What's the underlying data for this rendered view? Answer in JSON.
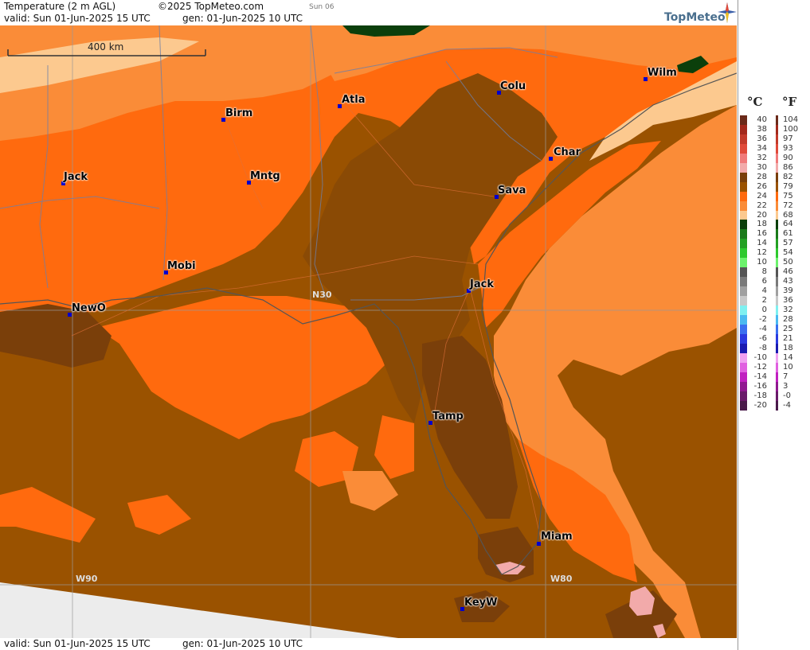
{
  "header": {
    "title": "Temperature (2 m AGL)",
    "copyright": "©2025 TopMeteo.com",
    "valid": "valid:  Sun  01-Jun-2025  15 UTC",
    "gen": "gen: 01-Jun-2025 10 UTC",
    "day": "Sun 06"
  },
  "footer": {
    "valid": "valid:  Sun  01-Jun-2025  15 UTC",
    "gen": "gen: 01-Jun-2025 10 UTC"
  },
  "logo": "TopMeteo",
  "scale_label": "400 km",
  "grid_labels": {
    "lat": "N30",
    "lon_w90": "W90",
    "lon_w80": "W80"
  },
  "cities": [
    {
      "name": "Birm"
    },
    {
      "name": "Atla"
    },
    {
      "name": "Colu"
    },
    {
      "name": "Wilm"
    },
    {
      "name": "Jack"
    },
    {
      "name": "Mntg"
    },
    {
      "name": "Char"
    },
    {
      "name": "Sava"
    },
    {
      "name": "Mobi"
    },
    {
      "name": "Jack"
    },
    {
      "name": "NewO"
    },
    {
      "name": "Tamp"
    },
    {
      "name": "Miam"
    },
    {
      "name": "KeyW"
    }
  ],
  "legend": {
    "unit_c": "°C",
    "unit_f": "°F",
    "rows": [
      {
        "c": "40",
        "f": "104",
        "color": "#6b2a1a"
      },
      {
        "c": "38",
        "f": "100",
        "color": "#a3291c"
      },
      {
        "c": "36",
        "f": "97",
        "color": "#c23a2a"
      },
      {
        "c": "34",
        "f": "93",
        "color": "#e04a3a"
      },
      {
        "c": "32",
        "f": "90",
        "color": "#f07a7a"
      },
      {
        "c": "30",
        "f": "86",
        "color": "#f2aaaa"
      },
      {
        "c": "28",
        "f": "82",
        "color": "#7a3f0a"
      },
      {
        "c": "26",
        "f": "79",
        "color": "#9a5200"
      },
      {
        "c": "24",
        "f": "75",
        "color": "#ff6a0e"
      },
      {
        "c": "22",
        "f": "72",
        "color": "#fa8c38"
      },
      {
        "c": "20",
        "f": "68",
        "color": "#fcc98f"
      },
      {
        "c": "18",
        "f": "64",
        "color": "#0b3f0b"
      },
      {
        "c": "16",
        "f": "61",
        "color": "#1a7a1a"
      },
      {
        "c": "14",
        "f": "57",
        "color": "#23a023"
      },
      {
        "c": "12",
        "f": "54",
        "color": "#2ec92e"
      },
      {
        "c": "10",
        "f": "50",
        "color": "#6cf26c"
      },
      {
        "c": "8",
        "f": "46",
        "color": "#555555"
      },
      {
        "c": "6",
        "f": "43",
        "color": "#7a7a7a"
      },
      {
        "c": "4",
        "f": "39",
        "color": "#a0a0a0"
      },
      {
        "c": "2",
        "f": "36",
        "color": "#c8c8c8"
      },
      {
        "c": "0",
        "f": "32",
        "color": "#7ff0f0"
      },
      {
        "c": "-2",
        "f": "28",
        "color": "#4ab9f0"
      },
      {
        "c": "-4",
        "f": "25",
        "color": "#3a6ff0"
      },
      {
        "c": "-6",
        "f": "21",
        "color": "#2a3ae0"
      },
      {
        "c": "-8",
        "f": "18",
        "color": "#1a1ab0"
      },
      {
        "c": "-10",
        "f": "14",
        "color": "#f0a0f0"
      },
      {
        "c": "-12",
        "f": "10",
        "color": "#e060e0"
      },
      {
        "c": "-14",
        "f": "7",
        "color": "#c020c0"
      },
      {
        "c": "-16",
        "f": "3",
        "color": "#901890"
      },
      {
        "c": "-18",
        "f": "-0",
        "color": "#6a1a6a"
      },
      {
        "c": "-20",
        "f": "-4",
        "color": "#4a1a4a"
      }
    ]
  }
}
